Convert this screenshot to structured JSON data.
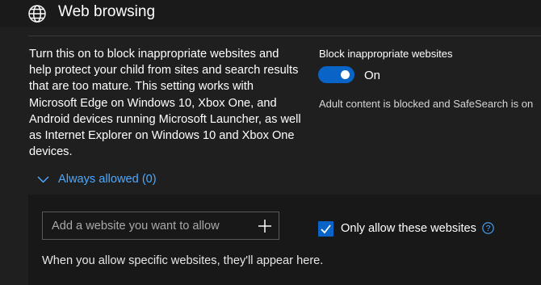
{
  "section": {
    "title": "Web browsing",
    "icon": "globe-icon",
    "description": "Turn this on to block inappropriate websites and help protect your child from sites and search results that are too mature. This setting works with Microsoft Edge on Windows 10, Xbox One, and Android devices running Microsoft Launcher, as well as Internet Explorer on Windows 10 and Xbox One devices."
  },
  "block_setting": {
    "label": "Block inappropriate websites",
    "toggle_on": true,
    "toggle_state": "On",
    "status": "Adult content is blocked and SafeSearch is on"
  },
  "always_allowed": {
    "label": "Always allowed (0)",
    "icon": "chevron-down-icon",
    "input_placeholder": "Add a website you want to allow",
    "add_icon": "plus-icon",
    "only_allow_label": "Only allow these websites",
    "only_allow_checked": true,
    "help_icon": "help-icon",
    "empty_note": "When you allow specific websites, they'll appear here."
  },
  "colors": {
    "accent": "#0a64c8",
    "link": "#4ca9ff",
    "background": "#1f1f1f"
  }
}
